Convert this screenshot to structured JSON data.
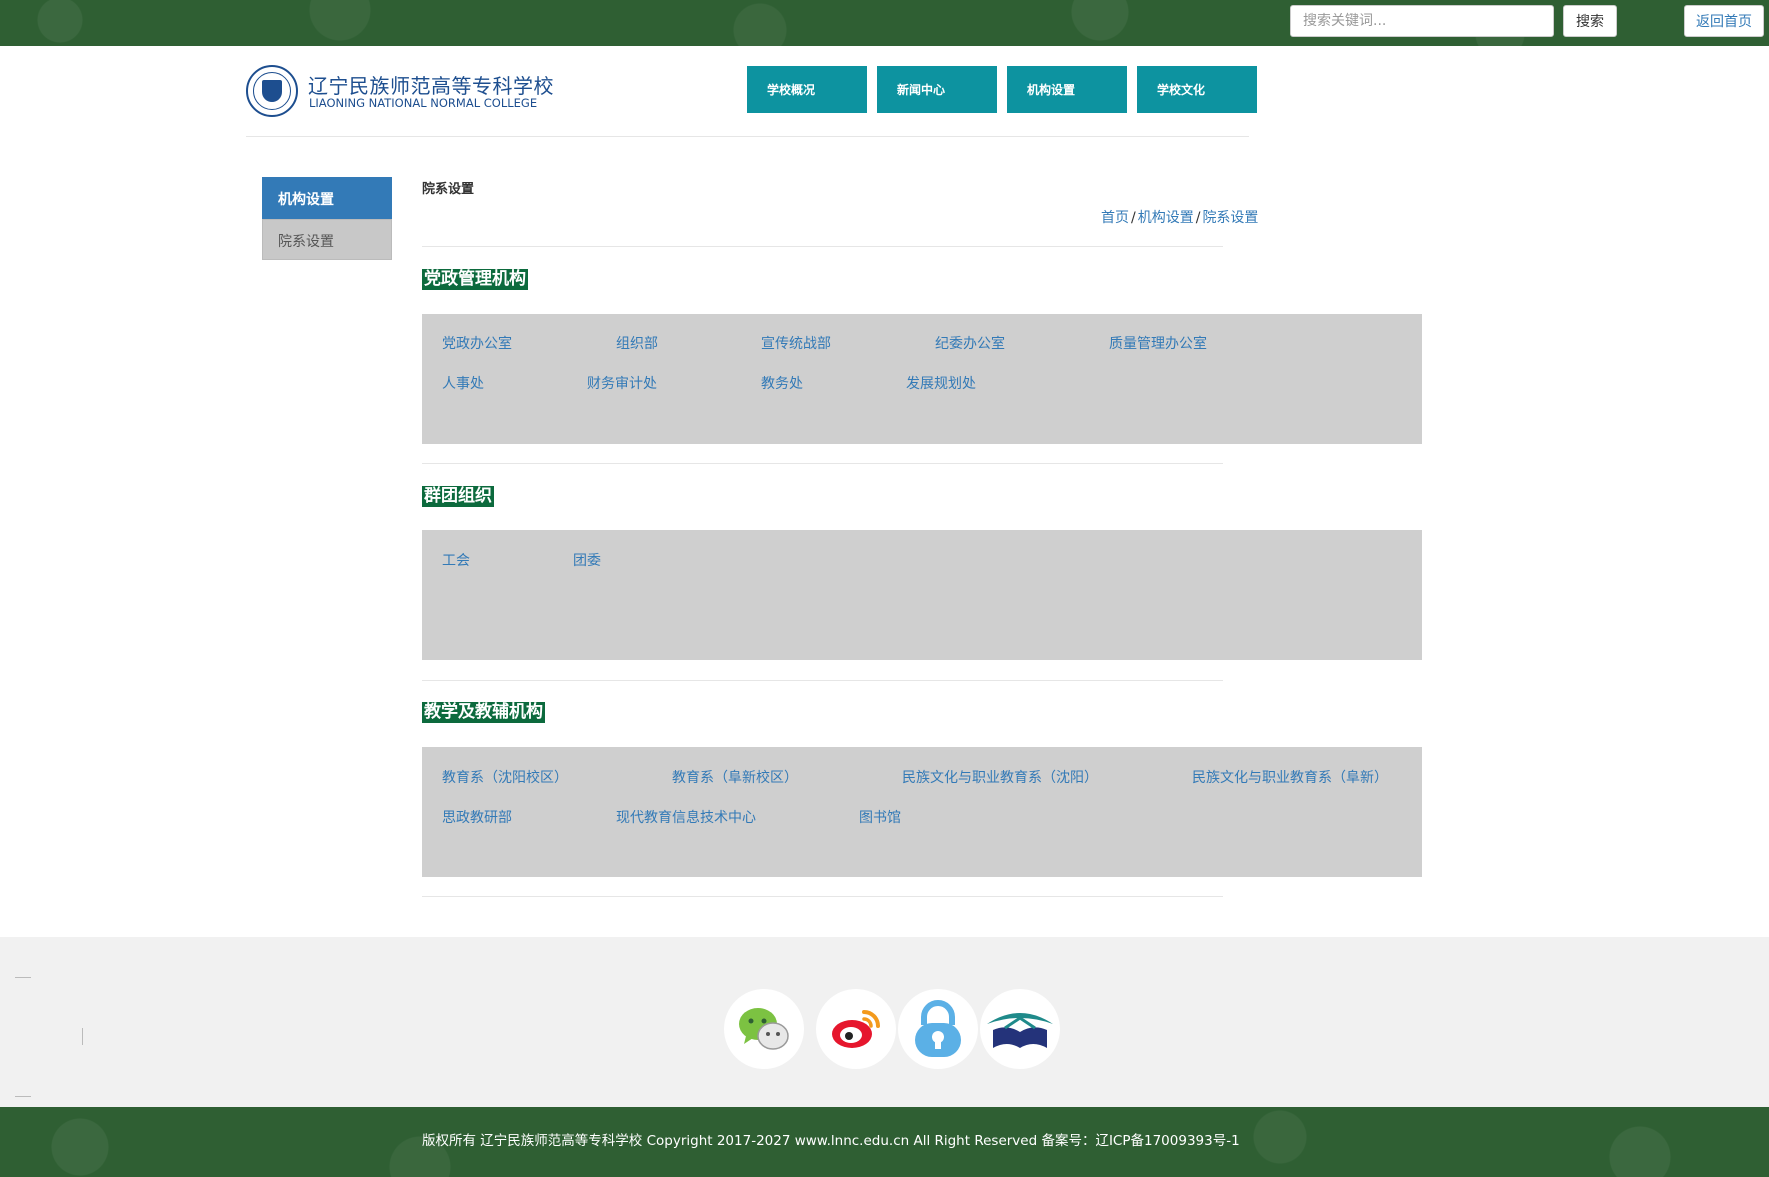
{
  "topbar": {
    "search_placeholder": "搜索关键词...",
    "search_button": "搜索",
    "home_button": "返回首页"
  },
  "header": {
    "logo_cn": "辽宁民族师范高等专科学校",
    "logo_en": "LIAONING NATIONAL NORMAL COLLEGE",
    "nav": [
      "学校概况",
      "新闻中心",
      "机构设置",
      "学校文化"
    ]
  },
  "sidebar": {
    "heading": "机构设置",
    "items": [
      "院系设置"
    ]
  },
  "main": {
    "title": "院系设置",
    "breadcrumb": [
      "首页",
      "机构设置",
      "院系设置"
    ],
    "sections": [
      {
        "title": "党政管理机构",
        "links": [
          "党政办公室",
          "组织部",
          "宣传统战部",
          "纪委办公室",
          "质量管理办公室",
          "人事处",
          "财务审计处",
          "教务处",
          "发展规划处"
        ]
      },
      {
        "title": "群团组织",
        "links": [
          "工会",
          "团委"
        ]
      },
      {
        "title": "教学及教辅机构",
        "links": [
          "教育系（沈阳校区）",
          "教育系（阜新校区）",
          "民族文化与职业教育系（沈阳）",
          "民族文化与职业教育系（阜新）",
          "思政教研部",
          "现代教育信息技术中心",
          "图书馆"
        ]
      }
    ]
  },
  "footer": {
    "social_icons": [
      "wechat-icon",
      "weibo-icon",
      "lock-icon",
      "book-icon"
    ],
    "copyright": "版权所有 辽宁民族师范高等专科学校 Copyright 2017-2027 www.lnnc.edu.cn All Right Reserved 备案号：辽ICP备17009393号-1"
  },
  "colors": {
    "topbar_green": "#2f5f33",
    "nav_teal": "#0d93a0",
    "section_green": "#0c6a3d",
    "link_blue": "#337ab7"
  }
}
